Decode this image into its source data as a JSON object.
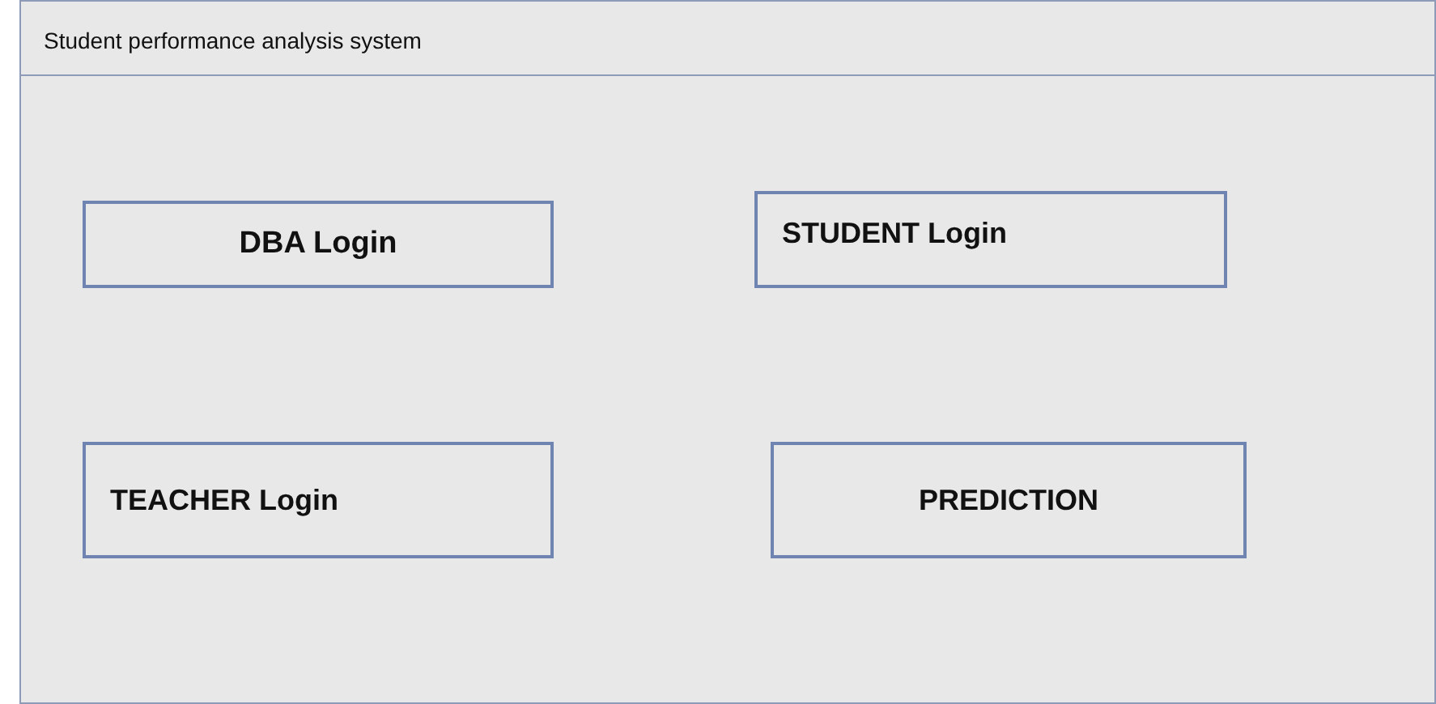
{
  "window": {
    "title": "Student performance analysis system"
  },
  "buttons": [
    {
      "label": "DBA Login"
    },
    {
      "label": "STUDENT Login"
    },
    {
      "label": "TEACHER Login"
    },
    {
      "label": "PREDICTION"
    }
  ]
}
